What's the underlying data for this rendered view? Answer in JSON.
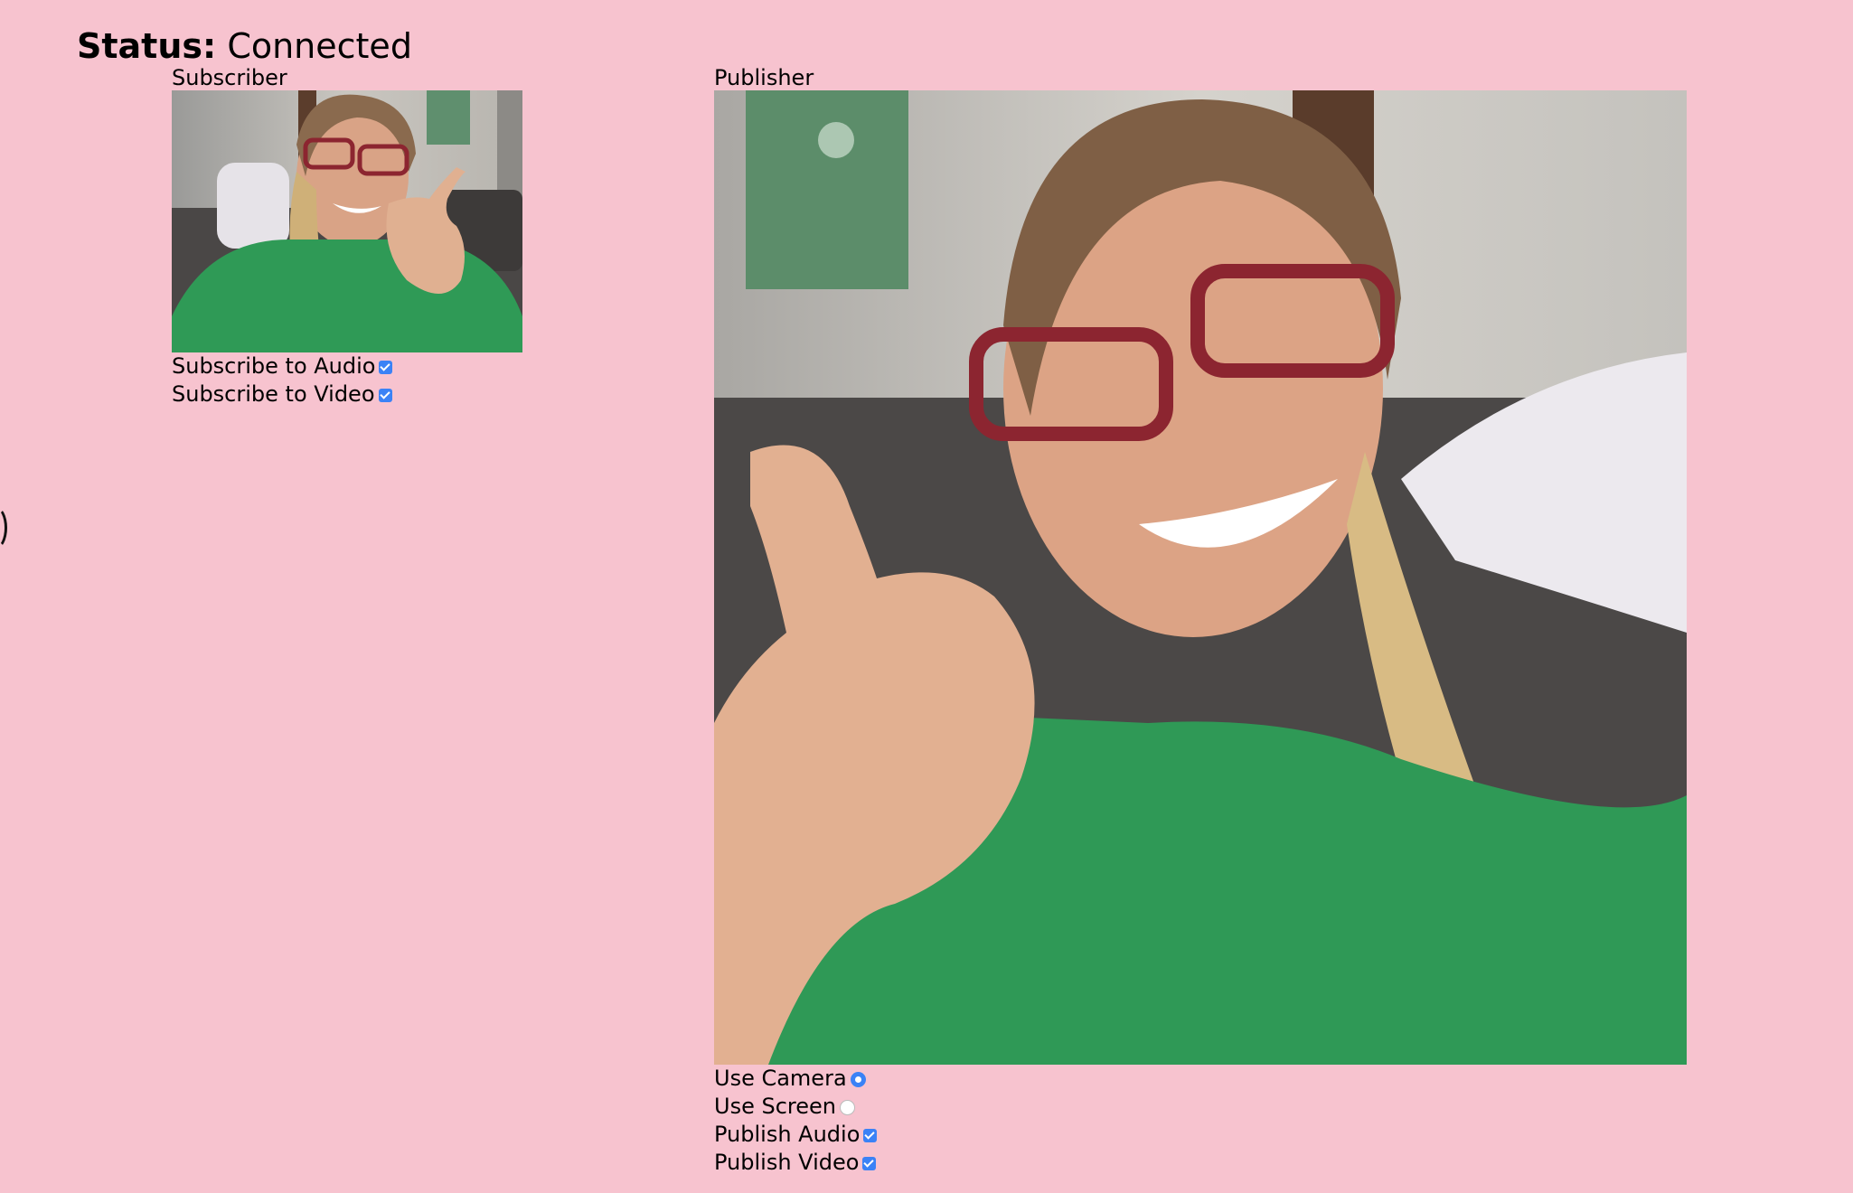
{
  "status": {
    "label": "Status:",
    "value": "Connected"
  },
  "subscriber": {
    "title": "Subscriber",
    "options": [
      {
        "label": "Subscribe to Audio",
        "type": "checkbox",
        "checked": true
      },
      {
        "label": "Subscribe to Video",
        "type": "checkbox",
        "checked": true
      }
    ]
  },
  "publisher": {
    "title": "Publisher",
    "options": [
      {
        "label": "Use Camera",
        "type": "radio",
        "checked": true
      },
      {
        "label": "Use Screen",
        "type": "radio",
        "checked": false
      },
      {
        "label": "Publish Audio",
        "type": "checkbox",
        "checked": true
      },
      {
        "label": "Publish Video",
        "type": "checkbox",
        "checked": true
      }
    ]
  },
  "colors": {
    "background": "#f7c3cf",
    "accent": "#3b82f6"
  }
}
